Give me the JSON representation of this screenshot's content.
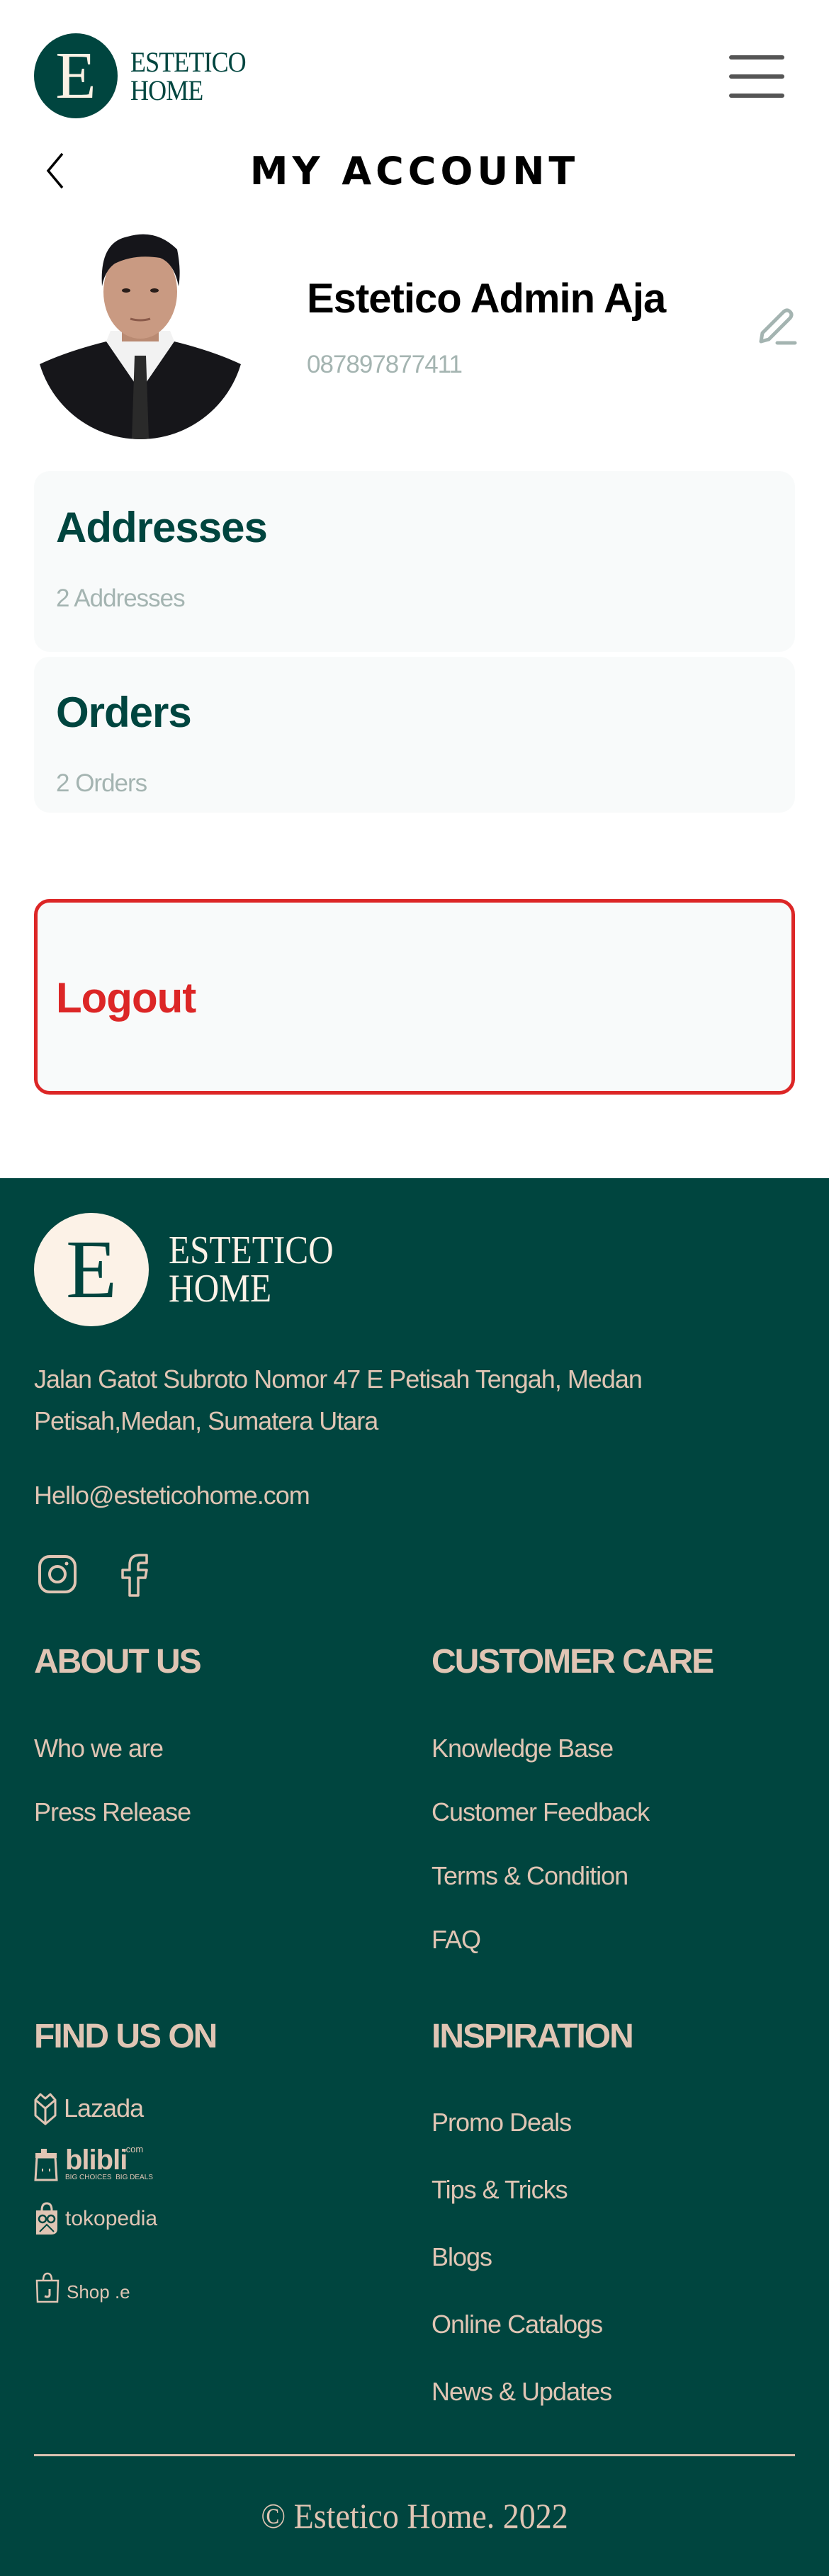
{
  "header": {
    "brand_line1": "ESTETICO",
    "brand_line2": "HOME",
    "logo_letter": "E",
    "logo_mini": "ESTETICO",
    "menu_icon": "hamburger-menu-icon"
  },
  "page": {
    "back_icon": "chevron-left-icon",
    "title": "MY ACCOUNT"
  },
  "profile": {
    "name": "Estetico Admin Aja",
    "phone": "087897877411",
    "edit_icon": "pencil-icon"
  },
  "cards": [
    {
      "title": "Addresses",
      "subtitle": "2 Addresses"
    },
    {
      "title": "Orders",
      "subtitle": "2 Orders"
    }
  ],
  "logout": {
    "label": "Logout"
  },
  "footer": {
    "brand_line1": "ESTETICO",
    "brand_line2": "HOME",
    "logo_letter": "E",
    "address_line1": "Jalan Gatot Subroto Nomor 47 E Petisah Tengah, Medan",
    "address_line2": "Petisah,Medan, Sumatera Utara",
    "email": "Hello@esteticohome.com",
    "social": [
      "instagram-icon",
      "facebook-icon"
    ],
    "about": {
      "heading": "ABOUT US",
      "links": [
        "Who we are",
        "Press Release"
      ]
    },
    "care": {
      "heading": "CUSTOMER CARE",
      "links": [
        "Knowledge Base",
        "Customer Feedback",
        "Terms & Condition",
        "FAQ"
      ]
    },
    "find": {
      "heading": "FIND US ON",
      "stores": [
        {
          "name": "Lazada",
          "icon": "lazada-logo-icon"
        },
        {
          "name": "blibli",
          "suffix": ".com",
          "tagline": "BIG CHOICES  BIG DEALS",
          "icon": "blibli-logo-icon"
        },
        {
          "name": "tokopedia",
          "icon": "tokopedia-logo-icon"
        },
        {
          "name": "Shop .e",
          "icon": "shopee-logo-icon"
        }
      ]
    },
    "inspiration": {
      "heading": "INSPIRATION",
      "links": [
        "Promo Deals",
        "Tips & Tricks",
        "Blogs",
        "Online Catalogs",
        "News & Updates"
      ]
    },
    "copyright": "© Estetico Home. 2022"
  },
  "colors": {
    "brand_green": "#00453f",
    "cream": "#fcf2e7",
    "footer_text": "#e0c5b4",
    "danger": "#dc2626",
    "muted": "#a4b4b1",
    "card_bg": "#f8fafa"
  }
}
